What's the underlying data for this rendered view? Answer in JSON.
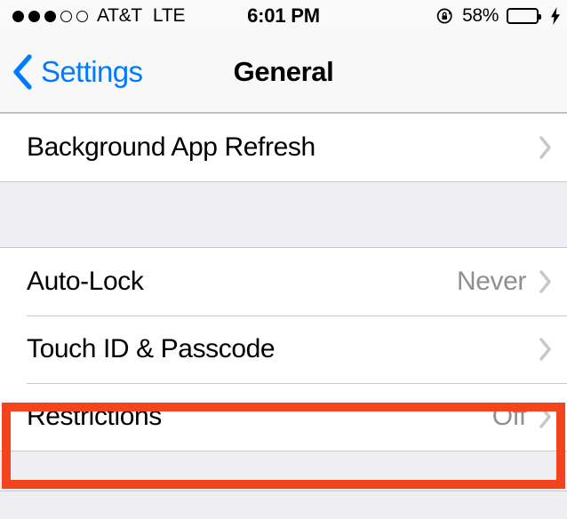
{
  "status_bar": {
    "signal_dots_filled": 3,
    "signal_dots_total": 5,
    "carrier": "AT&T",
    "network_type": "LTE",
    "time": "6:01 PM",
    "rotation_lock_icon": "rotation-lock-icon",
    "battery_percent_label": "58%",
    "battery_level": 58,
    "charging": true,
    "battery_color": "#4cd75b"
  },
  "nav_bar": {
    "back_label": "Settings",
    "back_chevron_icon": "chevron-left-icon",
    "title": "General",
    "accent_color": "#007aff"
  },
  "groups": [
    {
      "rows": [
        {
          "label": "Background App Refresh",
          "value": "",
          "accessory": "disclosure-chevron-icon",
          "highlighted": false
        }
      ]
    },
    {
      "rows": [
        {
          "label": "Auto-Lock",
          "value": "Never",
          "accessory": "disclosure-chevron-icon",
          "highlighted": false
        },
        {
          "label": "Touch ID & Passcode",
          "value": "",
          "accessory": "disclosure-chevron-icon",
          "highlighted": false
        },
        {
          "label": "Restrictions",
          "value": "Off",
          "accessory": "disclosure-chevron-icon",
          "highlighted": true
        }
      ]
    }
  ],
  "annotation": {
    "target_row_label": "Restrictions",
    "border_color": "#f4441e"
  }
}
